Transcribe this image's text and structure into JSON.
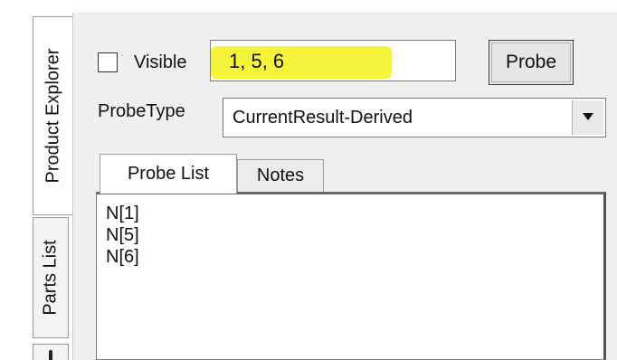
{
  "side_tabs": [
    {
      "label": "Product Explorer",
      "active": true
    },
    {
      "label": "Parts List",
      "active": false
    },
    {
      "label": "",
      "active": false
    }
  ],
  "visible": {
    "label": "Visible",
    "checked": false
  },
  "probe_input": {
    "value": "1, 5, 6",
    "highlight_color": "#f4f43a"
  },
  "probe_button": {
    "label": "Probe"
  },
  "probe_type": {
    "label": "ProbeType",
    "selected": "CurrentResult-Derived"
  },
  "tabs": [
    {
      "label": "Probe List",
      "active": true
    },
    {
      "label": "Notes",
      "active": false
    }
  ],
  "probe_list": {
    "items": [
      "N[1]",
      "N[5]",
      "N[6]"
    ]
  },
  "icons": {
    "dropdown": "chevron-down-icon"
  }
}
